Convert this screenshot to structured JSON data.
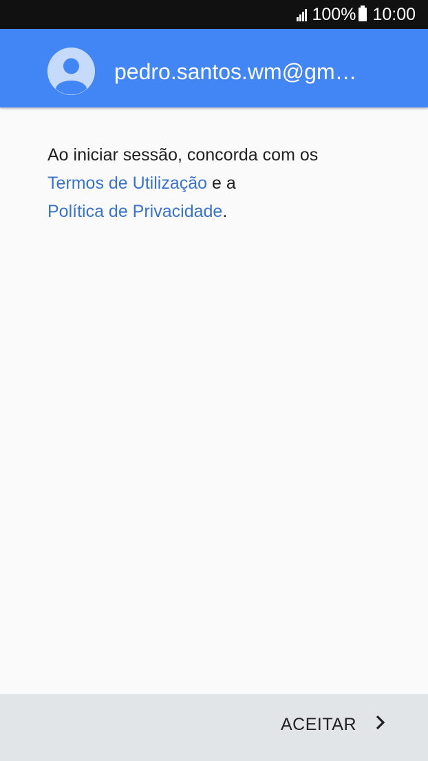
{
  "status_bar": {
    "battery_percent": "100%",
    "time": "10:00"
  },
  "account": {
    "email": "pedro.santos.wm@gm…"
  },
  "terms": {
    "intro": "Ao iniciar sessão, concorda com os",
    "terms_link": "Termos de Utilização",
    "connector": "e a",
    "privacy_link": "Política de Privacidade",
    "end": "."
  },
  "footer": {
    "accept_label": "ACEITAR"
  },
  "colors": {
    "header": "#4285f4",
    "link": "#3a73c8",
    "footer": "#e2e5e7"
  },
  "icons": {
    "signal": "signal-icon",
    "battery": "battery-icon",
    "avatar": "account-avatar-icon",
    "chevron": "chevron-right-icon"
  }
}
